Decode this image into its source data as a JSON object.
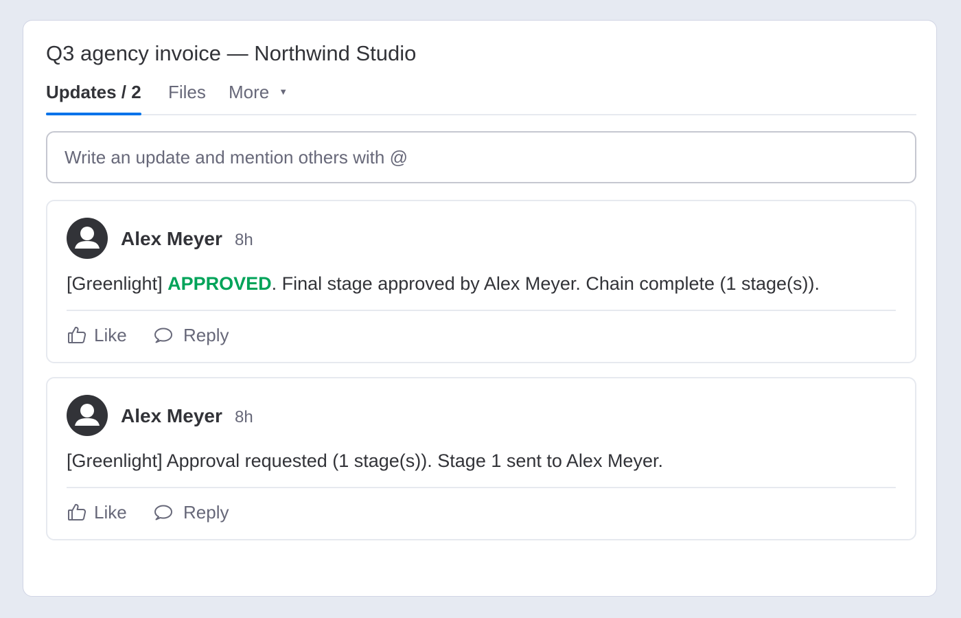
{
  "item": {
    "title": "Q3 agency invoice — Northwind Studio"
  },
  "tabs": [
    {
      "label": "Updates / 2",
      "active": true
    },
    {
      "label": "Files",
      "active": false
    },
    {
      "label": "More",
      "active": false
    }
  ],
  "composer": {
    "placeholder": "Write an update and mention others with @"
  },
  "updates": [
    {
      "author": "Alex Meyer",
      "time": "8h",
      "prefix": "[Greenlight] ",
      "status": "APPROVED",
      "body": ". Final stage approved by Alex Meyer. Chain complete (1 stage(s)).",
      "like_label": "Like",
      "reply_label": "Reply"
    },
    {
      "author": "Alex Meyer",
      "time": "8h",
      "body": "[Greenlight] Approval requested (1 stage(s)). Stage 1 sent to Alex Meyer.",
      "like_label": "Like",
      "reply_label": "Reply"
    }
  ],
  "colors": {
    "accent": "#0073ea",
    "approved": "#00a359",
    "text": "#323338",
    "muted": "#676879",
    "background": "#e6eaf2"
  },
  "icons": {
    "avatar": "person-icon",
    "more": "caret-down-icon",
    "like": "thumbs-up-icon",
    "reply": "speech-bubble-icon"
  }
}
